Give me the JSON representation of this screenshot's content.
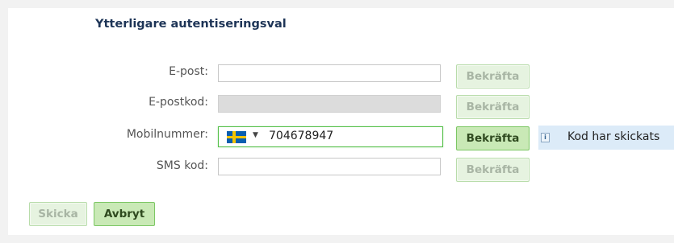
{
  "section": {
    "title": "Ytterligare autentiseringsval"
  },
  "fields": {
    "email": {
      "label": "E-post:",
      "value": "",
      "confirm_label": "Bekräfta"
    },
    "email_code": {
      "label": "E-postkod:",
      "value": "",
      "confirm_label": "Bekräfta"
    },
    "mobile": {
      "label": "Mobilnummer:",
      "country": "SE",
      "flag_icon": "sweden-flag-icon",
      "value": "704678947",
      "confirm_label": "Bekräfta"
    },
    "sms_code": {
      "label": "SMS kod:",
      "value": "",
      "confirm_label": "Bekräfta"
    }
  },
  "notice": {
    "icon": "info-icon",
    "text": "Kod har skickats"
  },
  "actions": {
    "send_label": "Skicka",
    "cancel_label": "Avbryt"
  },
  "colors": {
    "title": "#1e3557",
    "accent_green": "#56c04a",
    "notice_bg": "#dcebf8"
  }
}
